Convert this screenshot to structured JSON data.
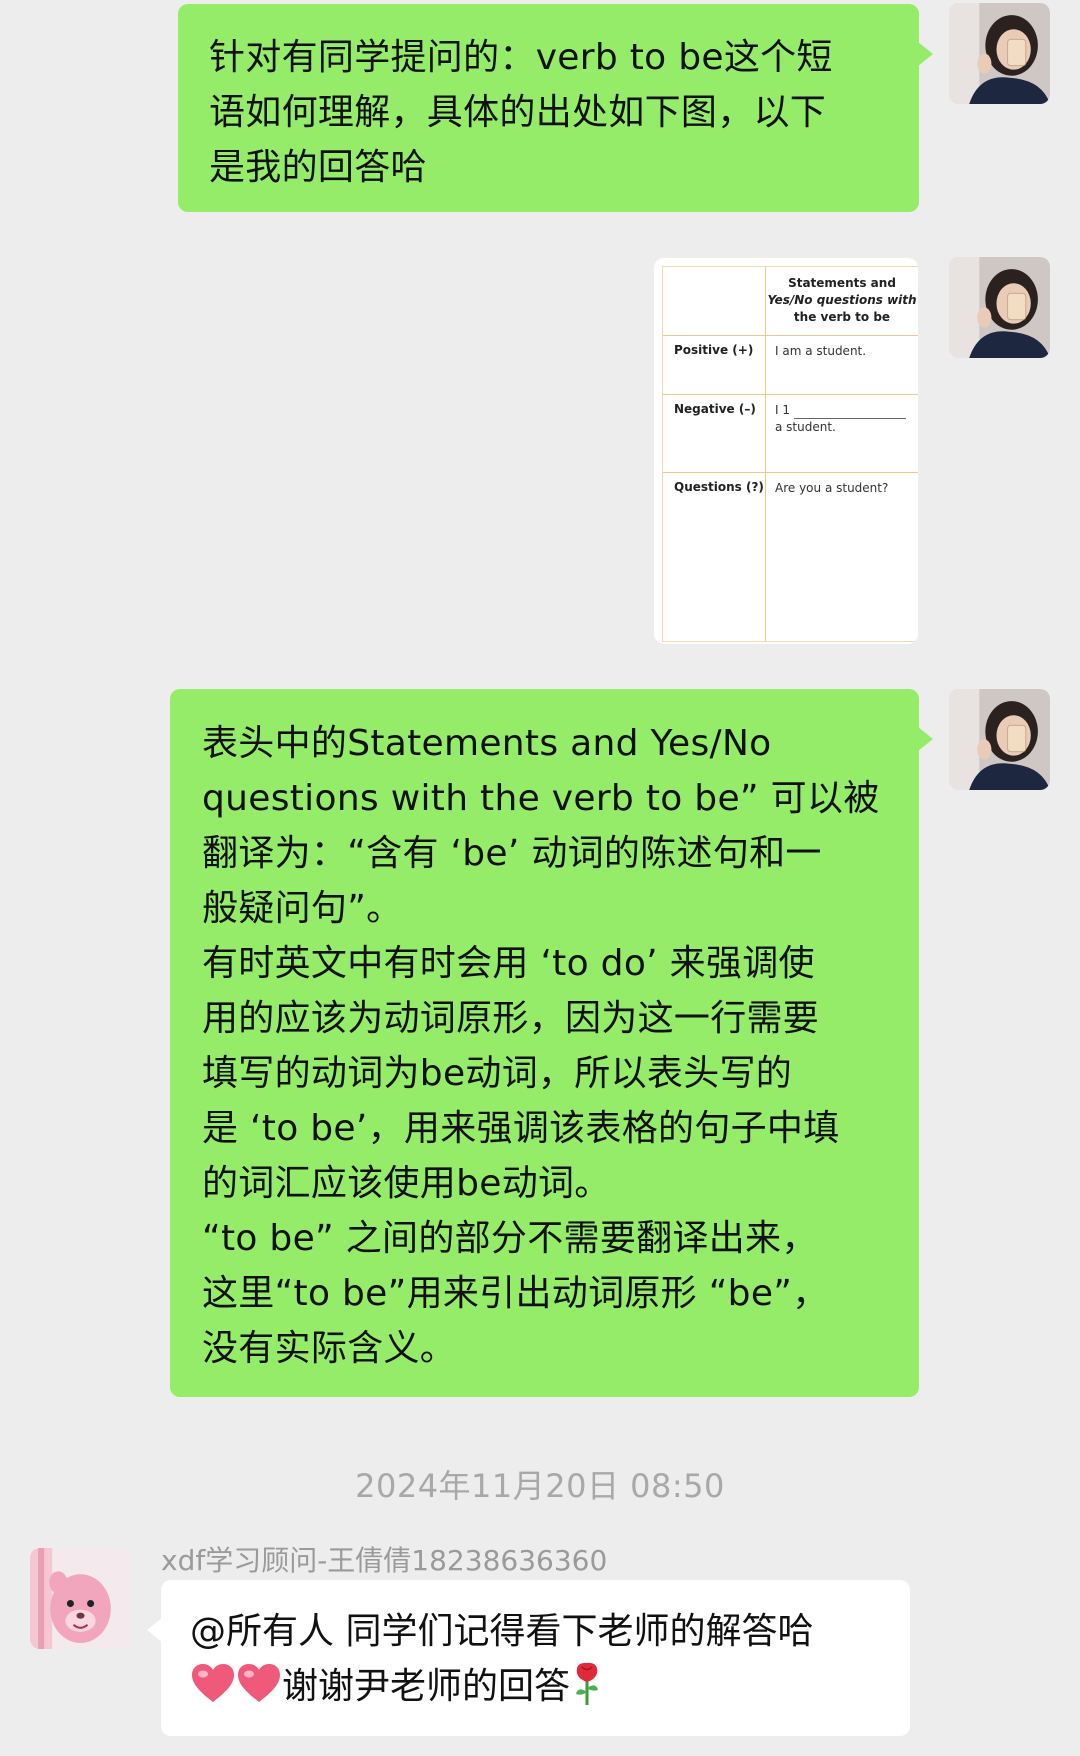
{
  "messages": [
    {
      "type": "text",
      "direction": "out",
      "lines": [
        "针对有同学提问的：verb to be这个短",
        "语如何理解，具体的出处如下图，以下",
        "是我的回答哈"
      ]
    },
    {
      "type": "image",
      "direction": "out",
      "table": {
        "header_lines": [
          "Statements and",
          "Yes/No questions with",
          "the verb to be"
        ],
        "rows": [
          {
            "label": "Positive (+)",
            "lines": [
              "I am a student."
            ]
          },
          {
            "label": "Negative (–)",
            "lines": [
              "I 1",
              "a student."
            ]
          },
          {
            "label": "Questions (?)",
            "lines": [
              "Are you a student?"
            ]
          }
        ]
      }
    },
    {
      "type": "text",
      "direction": "out",
      "lines": [
        "表头中的Statements and Yes/No",
        "questions with the verb to be” 可以被",
        "翻译为：“含有 ‘be’ 动词的陈述句和一",
        "般疑问句”。",
        "有时英文中有时会用 ‘to do’ 来强调使",
        "用的应该为动词原形，因为这一行需要",
        "填写的动词为be动词，所以表头写的",
        "是 ‘to be’，用来强调该表格的句子中填",
        "的词汇应该使用be动词。",
        "“to be” 之间的部分不需要翻译出来，",
        "这里“to be”用来引出动词原形 “be”，",
        "没有实际含义。"
      ]
    }
  ],
  "timestamp": "2024年11月20日 08:50",
  "incoming": {
    "sender": "xdf学习顾问-王倩倩18238636360",
    "line1": "@所有人 同学们记得看下老师的解答哈",
    "line2_text": "谢谢尹老师的回答",
    "emoji": [
      "heart",
      "heart",
      "rose"
    ]
  },
  "colors": {
    "background": "#ededed",
    "bubble_out": "#95ec69",
    "bubble_in": "#ffffff",
    "timestamp": "#a8a8a8"
  }
}
